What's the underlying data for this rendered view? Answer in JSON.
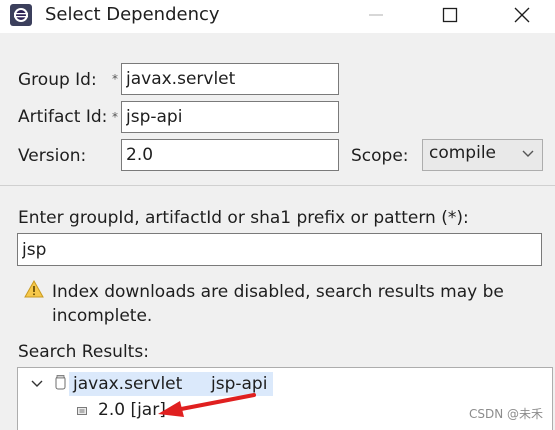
{
  "window": {
    "title": "Select Dependency",
    "controls": [
      "minimize",
      "maximize",
      "close"
    ]
  },
  "form": {
    "group_id": {
      "label": "Group Id:",
      "value": "javax.servlet",
      "required_marker": "*"
    },
    "artifact_id": {
      "label": "Artifact Id:",
      "value": "jsp-api",
      "required_marker": "*"
    },
    "version": {
      "label": "Version:",
      "value": "2.0"
    },
    "scope": {
      "label": "Scope:",
      "value": "compile"
    }
  },
  "search": {
    "prompt": "Enter groupId, artifactId or sha1 prefix or pattern (*):",
    "query": "jsp"
  },
  "warning": {
    "icon": "warning-icon",
    "text": "Index downloads are disabled, search results may be incomplete."
  },
  "results": {
    "label": "Search Results:",
    "items": [
      {
        "group": "javax.servlet",
        "artifact": "jsp-api",
        "expanded": true,
        "versions": [
          "2.0 [jar]"
        ]
      }
    ]
  },
  "annotation": {
    "arrow_color": "#e02020"
  },
  "watermark": "CSDN @未禾"
}
